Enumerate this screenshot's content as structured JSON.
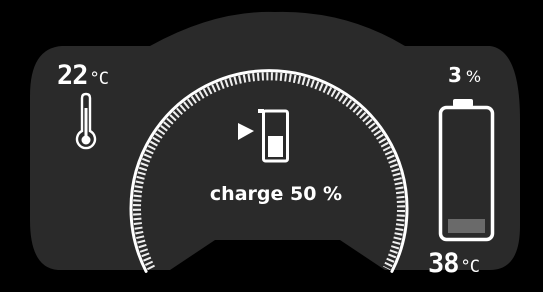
{
  "cabin_temperature": {
    "value": "22",
    "unit": "°C"
  },
  "battery": {
    "level_value": "3",
    "level_unit": "%",
    "level_fraction": 0.03,
    "temperature_value": "38",
    "temperature_unit": "°C"
  },
  "charging": {
    "text": "charge 50 %",
    "fraction": 0.5
  },
  "gauge": {
    "track_color": "#555555",
    "fill_color": "#ffffff"
  },
  "colors": {
    "background": "#000000",
    "panel": "#2a2a2a",
    "text": "#ffffff",
    "battery_fill": "#6a6a6a"
  },
  "icons": {
    "left": "thermometer-icon",
    "center": "charging-battery-icon",
    "right": "battery-icon"
  }
}
